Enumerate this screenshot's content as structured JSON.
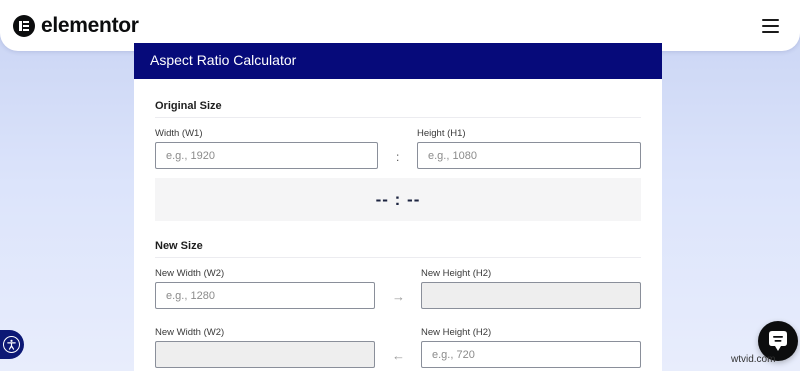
{
  "header": {
    "brand": "elementor",
    "logo_icon": "elementor-logo-icon",
    "menu_icon": "hamburger-menu-icon"
  },
  "calculator": {
    "title": "Aspect Ratio Calculator",
    "title_bar_color": "#060a7a",
    "original": {
      "heading": "Original Size",
      "width_label": "Width (W1)",
      "width_placeholder": "e.g., 1920",
      "width_value": "",
      "separator": ":",
      "height_label": "Height (H1)",
      "height_placeholder": "e.g., 1080",
      "height_value": "",
      "ratio_result": "-- : --"
    },
    "new_size": {
      "heading": "New Size",
      "row1": {
        "width_label": "New Width (W2)",
        "width_placeholder": "e.g., 1280",
        "arrow_icon": "arrow-right-icon",
        "arrow_glyph": "→",
        "height_label": "New Height (H2)",
        "height_value": ""
      },
      "row2": {
        "width_label": "New Width (W2)",
        "width_value": "",
        "arrow_icon": "arrow-left-icon",
        "arrow_glyph": "←",
        "height_label": "New Height (H2)",
        "height_placeholder": "e.g., 720"
      }
    }
  },
  "floating": {
    "accessibility_icon": "accessibility-icon",
    "chat_icon": "chat-bubble-icon"
  },
  "watermark": "wtvid.com"
}
